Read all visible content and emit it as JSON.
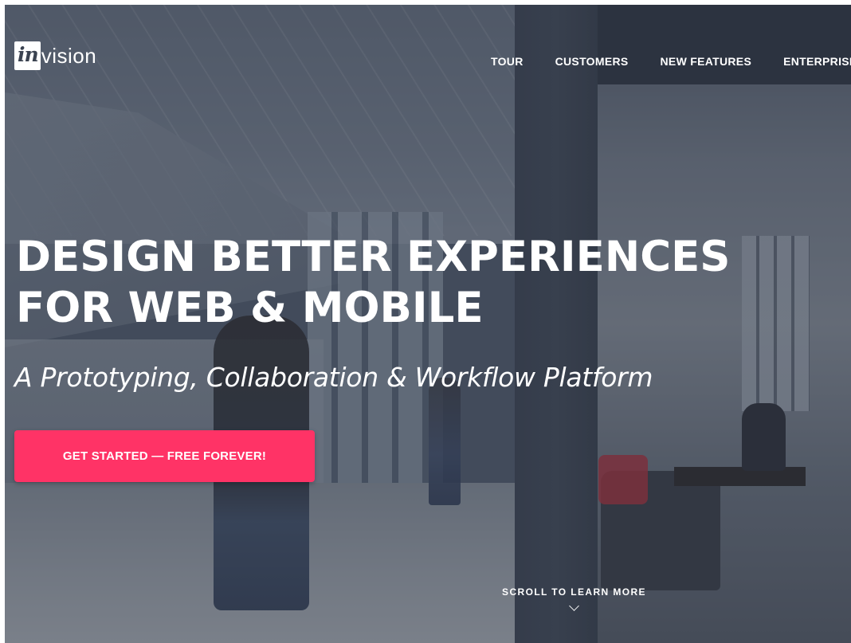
{
  "header": {
    "logo_mark": "in",
    "logo_text": "vision",
    "nav": [
      {
        "label": "TOUR"
      },
      {
        "label": "CUSTOMERS"
      },
      {
        "label": "NEW FEATURES"
      },
      {
        "label": "ENTERPRISE"
      }
    ]
  },
  "hero": {
    "headline_line1": "DESIGN BETTER EXPERIENCES",
    "headline_line2": "FOR WEB & MOBILE",
    "subheadline": "A Prototyping, Collaboration & Workflow Platform",
    "cta_label": "GET STARTED — FREE FOREVER!",
    "scroll_label": "SCROLL TO LEARN MORE"
  },
  "colors": {
    "cta": "#ff3366",
    "text": "#ffffff",
    "overlay": "#283040"
  },
  "icons": {
    "scroll": "chevron-down-icon"
  }
}
